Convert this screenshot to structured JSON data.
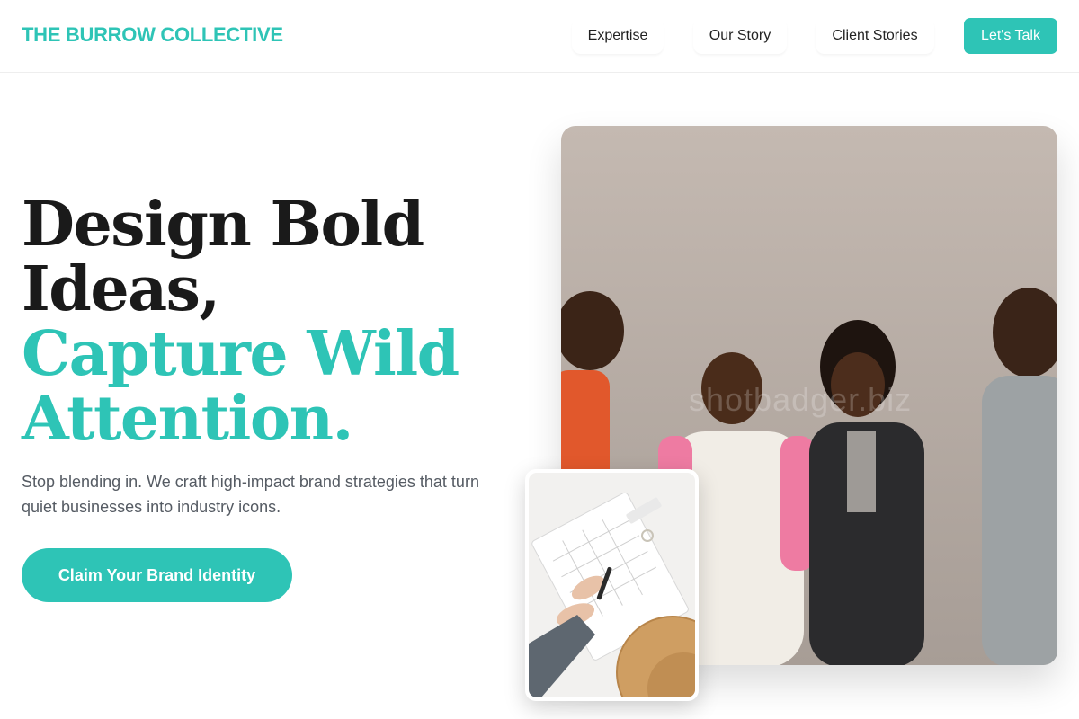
{
  "nav": {
    "brand": "THE BURROW COLLECTIVE",
    "links": [
      "Expertise",
      "Our Story",
      "Client Stories"
    ],
    "cta": "Let's Talk"
  },
  "hero": {
    "headline_line1": "Design Bold",
    "headline_line2": "Ideas,",
    "headline_line3": "Capture Wild",
    "headline_line4": "Attention.",
    "subtext": "Stop blending in. We craft high-impact brand strategies that turn quiet businesses into industry icons.",
    "cta": "Claim Your Brand Identity"
  },
  "images": {
    "main_watermark": "shotbadger.biz"
  },
  "colors": {
    "accent": "#2ec4b6",
    "text_dark": "#1a1a1a",
    "text_muted": "#555b63"
  }
}
